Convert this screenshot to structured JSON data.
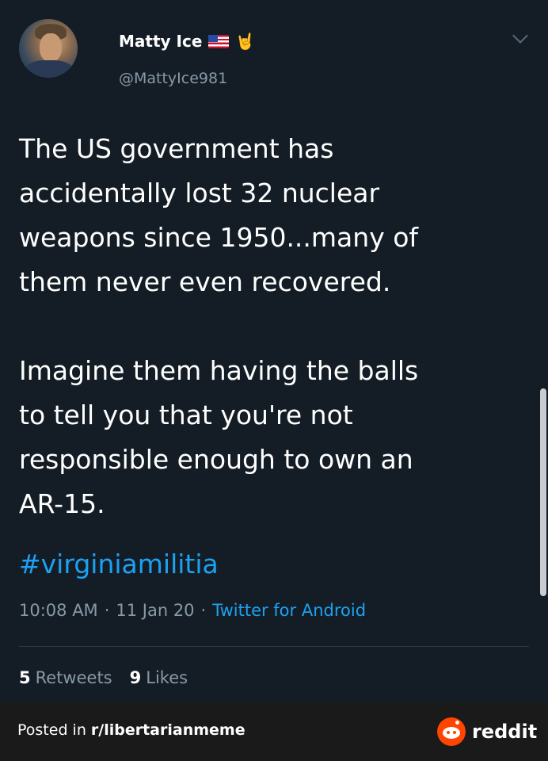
{
  "author": {
    "name": "Matty Ice",
    "handle": "@MattyIce981",
    "badges": [
      "us-flag-icon",
      "rock-hand-icon"
    ]
  },
  "tweet": {
    "text": "The US government has\naccidentally  lost 32 nuclear\nweapons since 1950...many of\nthem never even recovered.\n\nImagine them having the balls\nto tell you that you're not\nresponsible enough to own an\nAR-15.",
    "hashtag": "#virginiamilitia",
    "time": "10:08 AM",
    "separator": "·",
    "date": "11 Jan 20",
    "source": "Twitter for Android"
  },
  "stats": {
    "retweets_count": "5",
    "retweets_label": "Retweets",
    "likes_count": "9",
    "likes_label": "Likes"
  },
  "footer": {
    "posted_prefix": "Posted in ",
    "subreddit": "r/libertarianmeme",
    "brand": "reddit"
  },
  "colors": {
    "background": "#141d26",
    "link": "#1da1f2",
    "muted": "#8899a6",
    "reddit_orange": "#ff4500"
  }
}
